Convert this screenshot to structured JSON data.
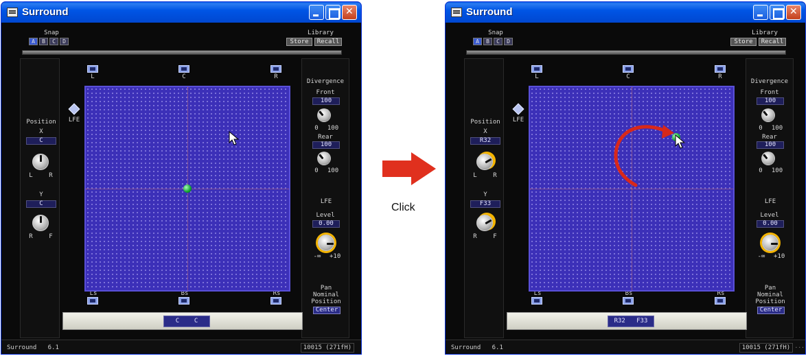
{
  "windows": [
    {
      "title": "Surround",
      "snap": {
        "label": "Snap",
        "buttons": [
          "A",
          "B",
          "C",
          "D"
        ]
      },
      "library": {
        "label": "Library",
        "store": "Store",
        "recall": "Recall"
      },
      "position": {
        "label": "Position",
        "x_label": "X",
        "x_value": "C",
        "x_min": "L",
        "x_max": "R",
        "y_label": "Y",
        "y_value": "C",
        "y_min": "R",
        "y_max": "F"
      },
      "speakers": {
        "l": "L",
        "c": "C",
        "r": "R",
        "lfe": "LFE",
        "ls": "Ls",
        "bs": "Bs",
        "rs": "Rs"
      },
      "divergence": {
        "label": "Divergence",
        "front_label": "Front",
        "front_value": "100",
        "rear_label": "Rear",
        "rear_value": "100",
        "min": "0",
        "max": "100"
      },
      "lfe": {
        "label": "LFE",
        "level_label": "Level",
        "level_value": "0.00",
        "min": "-∞",
        "max": "+10"
      },
      "pan": {
        "line1": "Pan",
        "line2": "Nominal",
        "line3": "Position",
        "value": "Center"
      },
      "bottom": {
        "x": "C",
        "y": "C"
      },
      "status": {
        "name": "Surround",
        "mode": "6.1",
        "right": "10015 (271fH)"
      }
    },
    {
      "title": "Surround",
      "snap": {
        "label": "Snap",
        "buttons": [
          "A",
          "B",
          "C",
          "D"
        ]
      },
      "library": {
        "label": "Library",
        "store": "Store",
        "recall": "Recall"
      },
      "position": {
        "label": "Position",
        "x_label": "X",
        "x_value": "R32",
        "x_min": "L",
        "x_max": "R",
        "y_label": "Y",
        "y_value": "F33",
        "y_min": "R",
        "y_max": "F"
      },
      "speakers": {
        "l": "L",
        "c": "C",
        "r": "R",
        "lfe": "LFE",
        "ls": "Ls",
        "bs": "Bs",
        "rs": "Rs"
      },
      "divergence": {
        "label": "Divergence",
        "front_label": "Front",
        "front_value": "100",
        "rear_label": "Rear",
        "rear_value": "100",
        "min": "0",
        "max": "100"
      },
      "lfe": {
        "label": "LFE",
        "level_label": "Level",
        "level_value": "0.00",
        "min": "-∞",
        "max": "+10"
      },
      "pan": {
        "line1": "Pan",
        "line2": "Nominal",
        "line3": "Position",
        "value": "Center"
      },
      "bottom": {
        "x": "R32",
        "y": "F33"
      },
      "status": {
        "name": "Surround",
        "mode": "6.1",
        "right": "10015 (271fH)",
        "grip": "..."
      }
    }
  ],
  "annotation": {
    "label": "Click",
    "arrow_color": "#e0301e"
  },
  "colors": {
    "grid": "#3c30b8",
    "puck": "#10a030",
    "titlebar": "#0055e5",
    "knob_ring": "#f4b400"
  }
}
